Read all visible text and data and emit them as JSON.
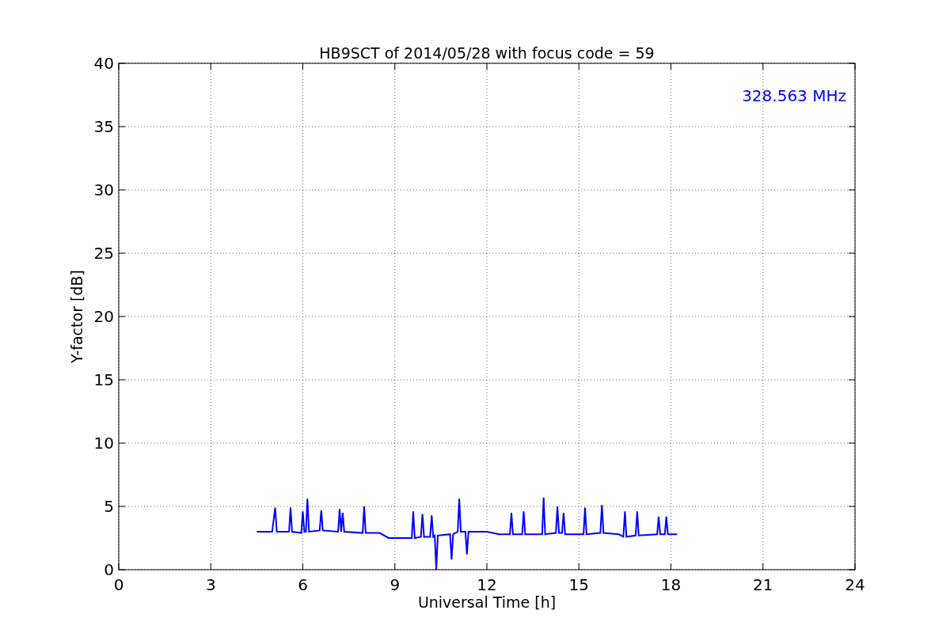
{
  "chart_data": {
    "type": "line",
    "title": "HB9SCT of 2014/05/28 with focus code = 59",
    "xlabel": "Universal Time [h]",
    "ylabel": "Y-factor [dB]",
    "xlim": [
      0,
      24
    ],
    "ylim": [
      0,
      40
    ],
    "xticks": [
      0,
      3,
      6,
      9,
      12,
      15,
      18,
      21,
      24
    ],
    "yticks": [
      0,
      5,
      10,
      15,
      20,
      25,
      30,
      35,
      40
    ],
    "x": [
      4.5,
      5.0,
      5.1,
      5.15,
      5.55,
      5.6,
      5.65,
      5.95,
      6.0,
      6.05,
      6.1,
      6.15,
      6.2,
      6.55,
      6.6,
      6.65,
      7.15,
      7.2,
      7.25,
      7.3,
      7.35,
      7.95,
      8.0,
      8.05,
      8.5,
      8.8,
      9.3,
      9.55,
      9.6,
      9.65,
      9.85,
      9.9,
      9.95,
      10.15,
      10.2,
      10.25,
      10.3,
      10.35,
      10.4,
      10.8,
      10.85,
      10.9,
      11.05,
      11.1,
      11.15,
      11.3,
      11.35,
      11.4,
      12.0,
      12.4,
      12.75,
      12.8,
      12.85,
      13.15,
      13.2,
      13.25,
      13.8,
      13.85,
      13.9,
      14.25,
      14.3,
      14.35,
      14.45,
      14.5,
      14.55,
      15.15,
      15.2,
      15.25,
      15.7,
      15.75,
      15.8,
      16.3,
      16.45,
      16.5,
      16.55,
      16.85,
      16.9,
      16.95,
      17.55,
      17.6,
      17.65,
      17.8,
      17.85,
      17.9,
      18.2
    ],
    "series": [
      {
        "color": "#0000ff",
        "values": [
          3.0,
          3.0,
          4.9,
          3.0,
          3.0,
          4.9,
          3.0,
          2.9,
          4.6,
          3.0,
          3.0,
          5.6,
          3.0,
          3.1,
          4.7,
          3.1,
          3.0,
          4.8,
          3.0,
          4.5,
          3.0,
          2.9,
          5.0,
          2.9,
          2.9,
          2.5,
          2.5,
          2.5,
          4.6,
          2.5,
          2.6,
          4.4,
          2.6,
          2.6,
          4.3,
          2.6,
          2.7,
          0.0,
          2.7,
          2.8,
          0.8,
          2.8,
          3.0,
          5.6,
          3.0,
          3.0,
          1.2,
          3.0,
          3.0,
          2.8,
          2.8,
          4.5,
          2.8,
          2.8,
          4.6,
          2.8,
          2.8,
          5.7,
          2.8,
          2.9,
          5.0,
          2.9,
          2.9,
          4.5,
          2.8,
          2.8,
          4.9,
          2.8,
          2.9,
          5.1,
          2.9,
          2.8,
          2.6,
          4.6,
          2.6,
          2.7,
          4.6,
          2.7,
          2.8,
          4.2,
          2.8,
          2.8,
          4.2,
          2.8,
          2.8
        ]
      }
    ],
    "grid": true,
    "annotations": [
      {
        "text": "328.563 MHz"
      }
    ]
  }
}
